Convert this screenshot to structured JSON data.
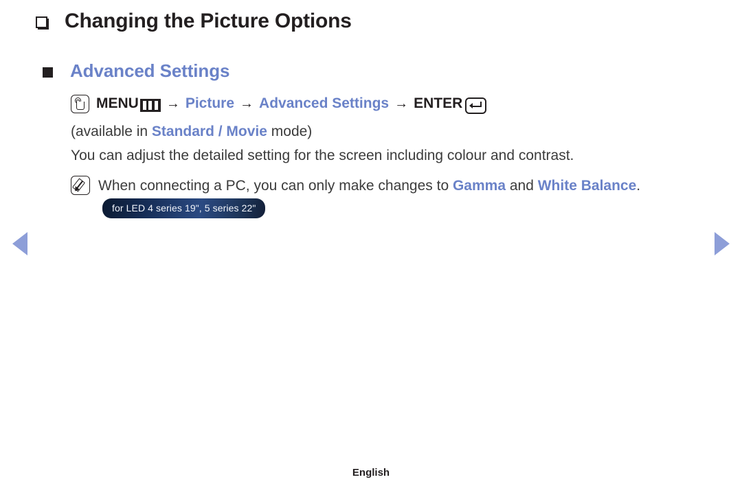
{
  "page": {
    "title": "Changing the Picture Options",
    "title_bullet_icon": "hollow-square-bullet-icon"
  },
  "section": {
    "bullet_icon": "filled-square-bullet-icon",
    "heading": "Advanced Settings"
  },
  "menu_path": {
    "press_icon": "press-button-icon",
    "menu_label": "MENU",
    "menu_bars_icon": "menu-bars-icon",
    "arrow1": "→",
    "picture_label": "Picture",
    "arrow2": "→",
    "advanced_settings_label": "Advanced Settings",
    "arrow3": "→",
    "enter_label": "ENTER",
    "enter_icon": "enter-key-icon"
  },
  "availability": {
    "prefix": "(available in ",
    "modes": "Standard / Movie",
    "suffix": " mode)"
  },
  "description": "You can adjust the detailed setting for the screen including colour and contrast.",
  "note": {
    "icon": "note-pencil-icon",
    "part1": "When connecting a PC, you can only make changes to ",
    "highlight1": "Gamma",
    "part2": " and ",
    "highlight2": "White Balance",
    "part3": ".",
    "badge": "for LED 4 series 19\", 5 series 22\""
  },
  "navigation": {
    "prev_icon": "previous-page-arrow",
    "next_icon": "next-page-arrow"
  },
  "footer": {
    "language": "English"
  },
  "colors": {
    "accent_blue": "#6a82c8",
    "arrow_blue": "#8d9ed8",
    "text_dark": "#231f20",
    "body_text": "#3c3c3c",
    "badge_dark": "#0b1a31"
  }
}
